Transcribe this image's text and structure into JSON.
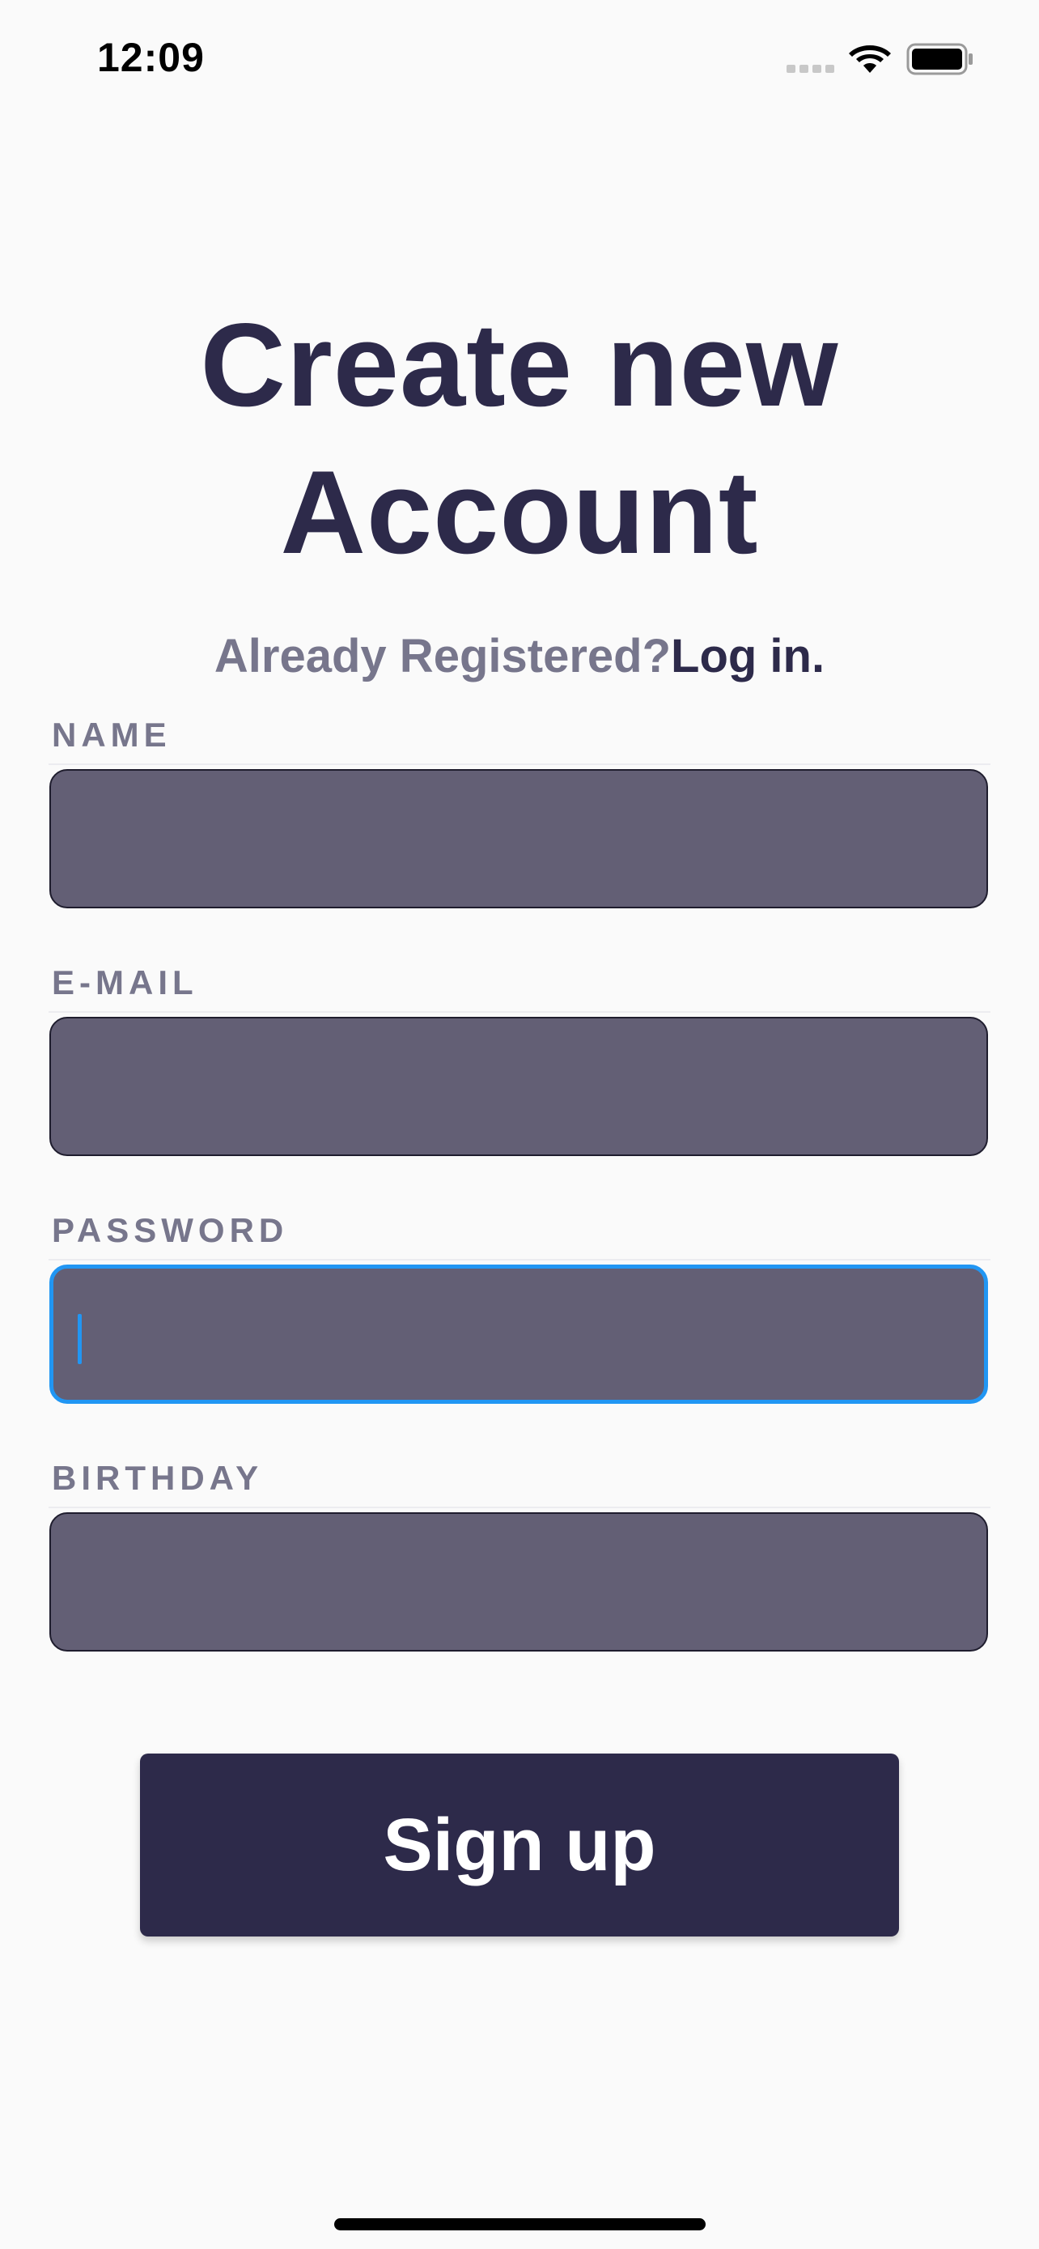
{
  "status_bar": {
    "time": "12:09",
    "icons": [
      "cellular-signal-icon",
      "wifi-icon",
      "battery-icon"
    ]
  },
  "screen": {
    "title_line1": "Create new",
    "title_line2": "Account",
    "already_registered": "Already Registered?",
    "login_link": "Log in."
  },
  "form": {
    "fields": [
      {
        "label": "NAME",
        "value": "",
        "focused": false
      },
      {
        "label": "E-MAIL",
        "value": "",
        "focused": false
      },
      {
        "label": "PASSWORD",
        "value": "",
        "focused": true
      },
      {
        "label": "BIRTHDAY",
        "value": "",
        "focused": false
      }
    ],
    "submit_label": "Sign up"
  },
  "colors": {
    "primary": "#2d2a4a",
    "muted_text": "#77768c",
    "input_fill": "#635f75",
    "focus_ring": "#2196f3",
    "background": "#fafafa"
  }
}
